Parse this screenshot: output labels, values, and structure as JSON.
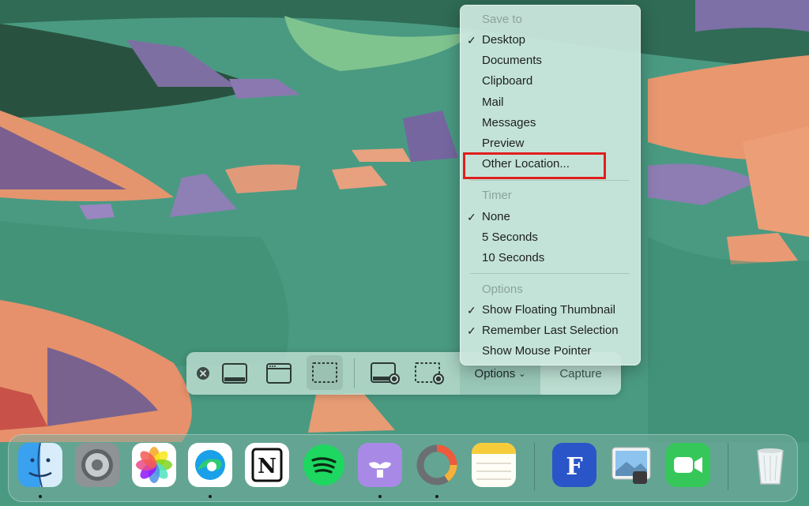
{
  "menu": {
    "save_to_header": "Save to",
    "save_to": [
      {
        "label": "Desktop",
        "checked": true
      },
      {
        "label": "Documents",
        "checked": false
      },
      {
        "label": "Clipboard",
        "checked": false
      },
      {
        "label": "Mail",
        "checked": false
      },
      {
        "label": "Messages",
        "checked": false
      },
      {
        "label": "Preview",
        "checked": false
      },
      {
        "label": "Other Location...",
        "checked": false
      }
    ],
    "timer_header": "Timer",
    "timer": [
      {
        "label": "None",
        "checked": true
      },
      {
        "label": "5 Seconds",
        "checked": false
      },
      {
        "label": "10 Seconds",
        "checked": false
      }
    ],
    "options_header": "Options",
    "options": [
      {
        "label": "Show Floating Thumbnail",
        "checked": true
      },
      {
        "label": "Remember Last Selection",
        "checked": true
      },
      {
        "label": "Show Mouse Pointer",
        "checked": false
      }
    ],
    "check_glyph": "✓",
    "highlight_color": "#e01e1e"
  },
  "toolbar": {
    "options_label": "Options",
    "options_chevron": "⌄",
    "capture_label": "Capture",
    "close_glyph": "✕"
  },
  "dock": {
    "items": [
      {
        "name": "finder-icon",
        "running": true
      },
      {
        "name": "system-settings-icon",
        "running": false
      },
      {
        "name": "photos-icon",
        "running": false
      },
      {
        "name": "edge-icon",
        "running": true
      },
      {
        "name": "notion-icon",
        "running": false,
        "glyph": "N"
      },
      {
        "name": "spotify-icon",
        "running": false
      },
      {
        "name": "bartender-icon",
        "running": true
      },
      {
        "name": "istat-icon",
        "running": true
      },
      {
        "name": "notes-icon",
        "running": false
      },
      {
        "name": "fenix-icon",
        "running": false,
        "glyph": "F"
      },
      {
        "name": "preview-icon",
        "running": false
      },
      {
        "name": "facetime-icon",
        "running": false
      },
      {
        "name": "trash-icon",
        "running": false
      }
    ]
  }
}
